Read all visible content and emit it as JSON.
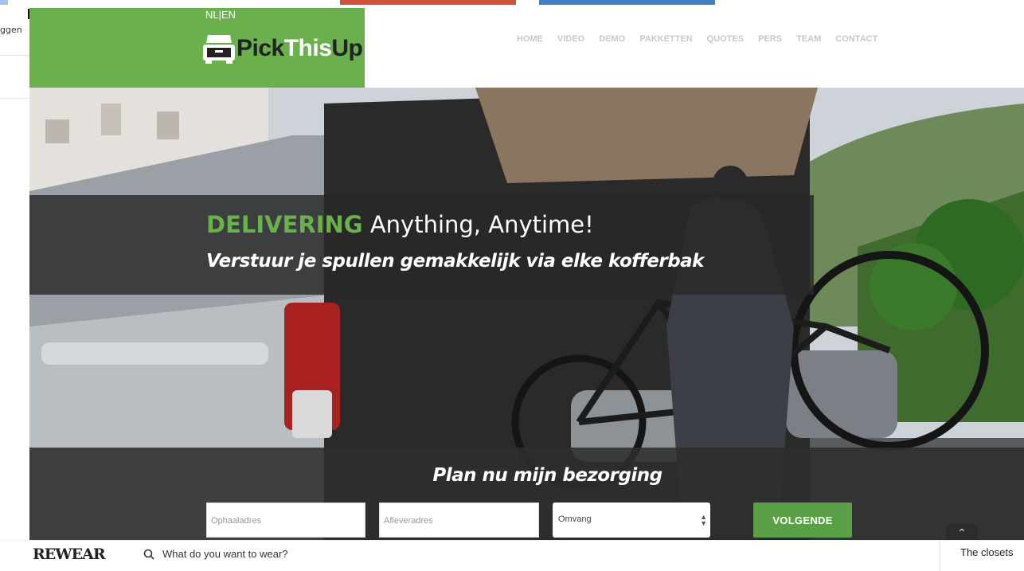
{
  "underlying_page": {
    "left_text": "ggen",
    "bottom": {
      "brand": "REWEAR",
      "search_placeholder": "What do you want to wear?",
      "right_text": "The closets"
    }
  },
  "site": {
    "lang_switch": "NL|EN",
    "logo": {
      "part1": "Pick",
      "part2": "This",
      "part3": "Up"
    },
    "nav": [
      "HOME",
      "VIDEO",
      "DEMO",
      "PAKKETTEN",
      "QUOTES",
      "PERS",
      "TEAM",
      "CONTACT"
    ],
    "hero": {
      "headline_highlight": "DELIVERING",
      "headline_rest": " Anything, Anytime!",
      "subheadline": "Verstuur je spullen gemakkelijk via elke kofferbak"
    },
    "booking": {
      "title": "Plan nu mijn bezorging",
      "pickup_placeholder": "Ophaaladres",
      "dropoff_placeholder": "Afleveradres",
      "size_select": "Omvang",
      "next_button": "VOLGENDE"
    },
    "scroll_top_label": "^"
  },
  "colors": {
    "brand_green": "#6ab04c",
    "button_green": "#5aa046",
    "nav_grey": "#c8c8c8",
    "banner_dark": "#282828"
  }
}
